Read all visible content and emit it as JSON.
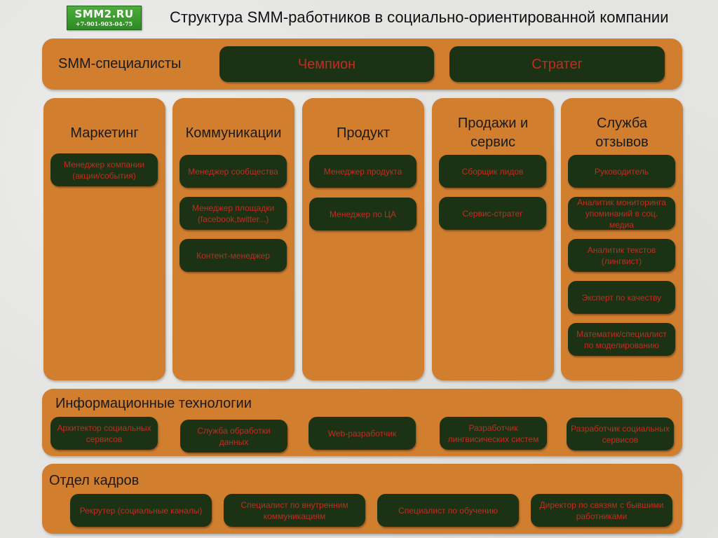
{
  "logo": {
    "name": "SMM2.RU",
    "phone": "+7-901-903-04-75"
  },
  "title": "Структура SMM-работников в социально-ориентированной компании",
  "top": {
    "label": "SMM-специалисты",
    "roles": [
      "Чемпион",
      "Стратег"
    ]
  },
  "columns": [
    {
      "title": "Маркетинг",
      "roles": [
        "Менеджер компании (акции/события)"
      ]
    },
    {
      "title": "Коммуникации",
      "roles": [
        "Менеджер сообщества",
        "Менеджер площадки (facebook,twitter...)",
        "Контент-менеджер"
      ]
    },
    {
      "title": "Продукт",
      "roles": [
        "Менеджер продукта",
        "Менеджер по ЦА"
      ]
    },
    {
      "title": "Продажи и сервис",
      "roles": [
        "Сборщик лидов",
        "Сервис-стратег"
      ]
    },
    {
      "title": "Служба отзывов",
      "roles": [
        "Руководитель",
        "Аналитик мониторинга упоминаний в соц. медиа",
        "Аналитик текстов (лингвист)",
        "Эксперт по качеству",
        "Математик/специалист по моделированию"
      ]
    }
  ],
  "it": {
    "title": "Информационные технологии",
    "roles": [
      "Архитектор социальных сервисов",
      "Служба обработки данных",
      "Web-разработчик",
      "Разработчик лингвисических систем",
      "Разработчик социальных сервисов"
    ]
  },
  "hr": {
    "title": "Отдел кадров",
    "roles": [
      "Рекрутер (социальные каналы)",
      "Специалист по внутренним коммуникациям",
      "Специалист по обучению",
      "Директор по связям с бывшими работниками"
    ]
  }
}
